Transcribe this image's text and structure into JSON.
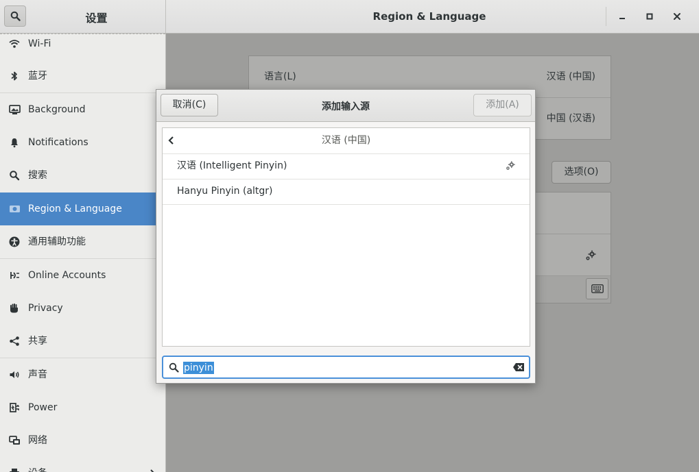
{
  "header": {
    "sidebar_title": "设置",
    "title": "Region & Language"
  },
  "sidebar": {
    "items": [
      {
        "label": "Wi-Fi",
        "icon": "wifi-icon"
      },
      {
        "label": "蓝牙",
        "icon": "bluetooth-icon"
      },
      {
        "label": "Background",
        "icon": "background-icon"
      },
      {
        "label": "Notifications",
        "icon": "bell-icon"
      },
      {
        "label": "搜索",
        "icon": "search-icon"
      },
      {
        "label": "Region & Language",
        "icon": "region-flag-icon"
      },
      {
        "label": "通用辅助功能",
        "icon": "accessibility-icon"
      },
      {
        "label": "Online Accounts",
        "icon": "online-accounts-icon"
      },
      {
        "label": "Privacy",
        "icon": "hand-icon"
      },
      {
        "label": "共享",
        "icon": "share-icon"
      },
      {
        "label": "声音",
        "icon": "speaker-icon"
      },
      {
        "label": "Power",
        "icon": "power-plug-icon"
      },
      {
        "label": "网络",
        "icon": "network-icon"
      },
      {
        "label": "设备",
        "icon": "printer-icon"
      }
    ],
    "selected_index": 5
  },
  "main": {
    "language_label": "语言(L)",
    "language_value": "汉语 (中国)",
    "formats_value": "中国 (汉语)",
    "options_button": "选项(O)"
  },
  "dialog": {
    "cancel_label": "取消(C)",
    "title": "添加输入源",
    "add_label": "添加(A)",
    "list_header": "汉语 (中国)",
    "rows": [
      {
        "label": "汉语 (Intelligent Pinyin)",
        "has_settings": true
      },
      {
        "label": "Hanyu Pinyin (altgr)",
        "has_settings": false
      }
    ],
    "search_value": "pinyin"
  },
  "colors": {
    "accent": "#4a86c7",
    "selection": "#3d8fd8"
  }
}
